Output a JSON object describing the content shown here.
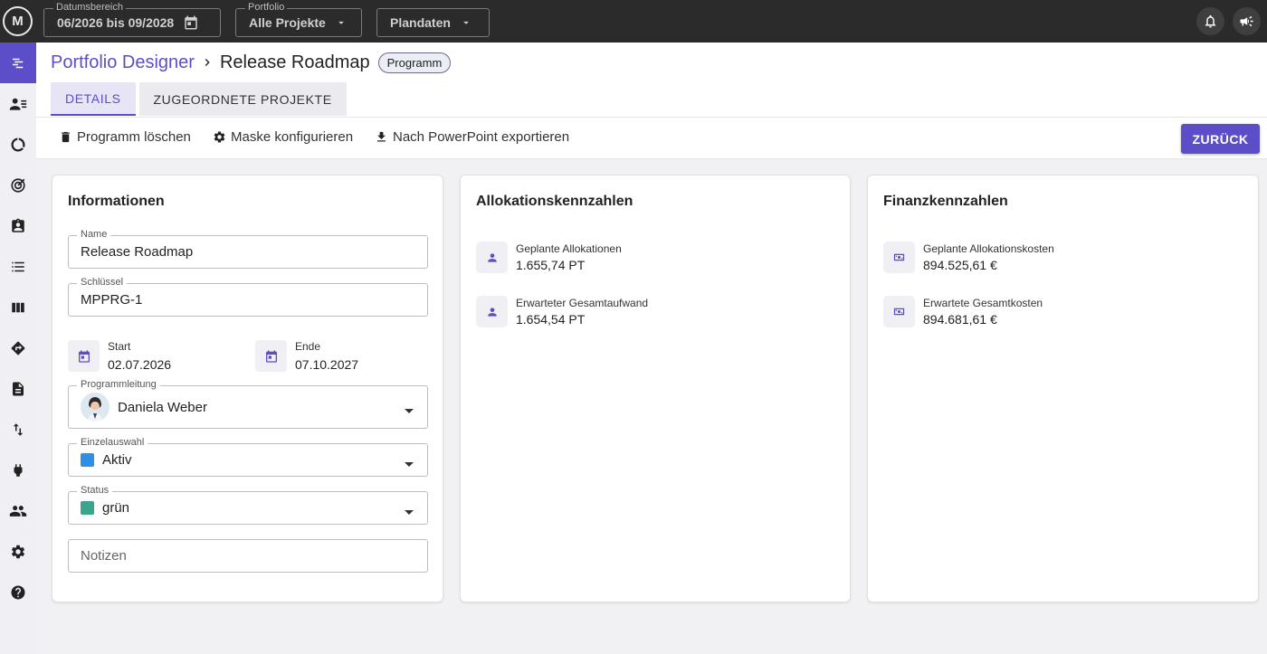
{
  "topbar": {
    "logo": "M",
    "date_range": {
      "label": "Datumsbereich",
      "value": "06/2026 bis 09/2028"
    },
    "portfolio": {
      "label": "Portfolio",
      "value": "Alle Projekte"
    },
    "data_source": {
      "value": "Plandaten"
    }
  },
  "breadcrumb": {
    "parent": "Portfolio Designer",
    "current": "Release Roadmap",
    "badge": "Programm"
  },
  "tabs": [
    {
      "label": "DETAILS",
      "active": true
    },
    {
      "label": "ZUGEORDNETE PROJEKTE",
      "active": false
    }
  ],
  "toolbar": {
    "delete": "Programm löschen",
    "configure": "Maske konfigurieren",
    "export": "Nach PowerPoint exportieren",
    "back": "ZURÜCK"
  },
  "info": {
    "title": "Informationen",
    "name": {
      "label": "Name",
      "value": "Release Roadmap"
    },
    "key": {
      "label": "Schlüssel",
      "value": "MPPRG-1"
    },
    "start": {
      "label": "Start",
      "value": "02.07.2026"
    },
    "end": {
      "label": "Ende",
      "value": "07.10.2027"
    },
    "lead": {
      "label": "Programmleitung",
      "value": "Daniela Weber"
    },
    "selection": {
      "label": "Einzelauswahl",
      "value": "Aktiv",
      "color": "#2f8fe6"
    },
    "status": {
      "label": "Status",
      "value": "grün",
      "color": "#3aa58a"
    },
    "notes": {
      "placeholder": "Notizen"
    }
  },
  "allocation": {
    "title": "Allokationskennzahlen",
    "items": [
      {
        "label": "Geplante Allokationen",
        "value": "1.655,74 PT"
      },
      {
        "label": "Erwarteter Gesamtaufwand",
        "value": "1.654,54 PT"
      }
    ]
  },
  "finance": {
    "title": "Finanzkennzahlen",
    "items": [
      {
        "label": "Geplante Allokationskosten",
        "value": "894.525,61 €"
      },
      {
        "label": "Erwartete Gesamtkosten",
        "value": "894.681,61 €"
      }
    ]
  },
  "colors": {
    "accent": "#5b4ec8",
    "topbar": "#2b2b2b"
  }
}
